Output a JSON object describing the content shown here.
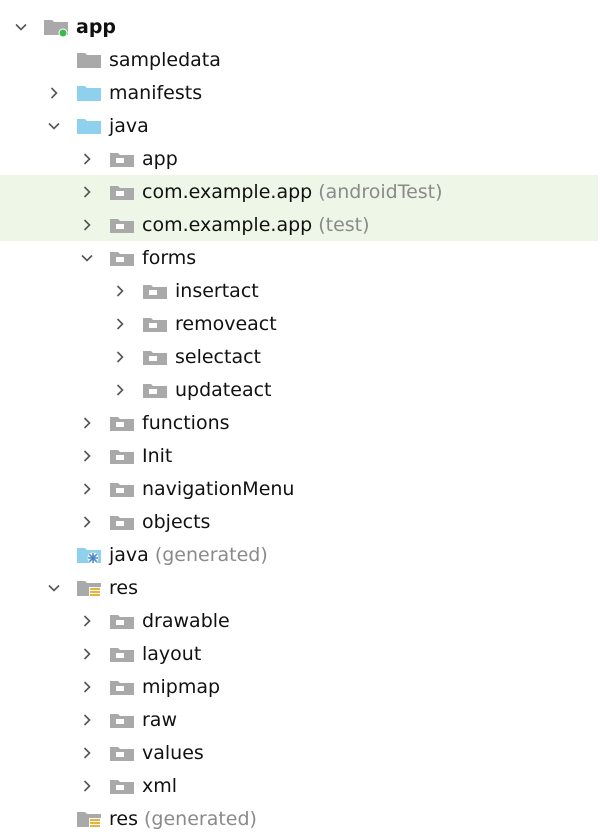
{
  "project_tree": {
    "items": [
      {
        "label": "app",
        "suffix": "",
        "depth": 0,
        "expander": "expanded",
        "icon": "module-folder-icon",
        "bold": true,
        "highlight": false
      },
      {
        "label": "sampledata",
        "suffix": "",
        "depth": 1,
        "expander": "none",
        "icon": "folder-icon",
        "bold": false,
        "highlight": false
      },
      {
        "label": "manifests",
        "suffix": "",
        "depth": 1,
        "expander": "collapsed",
        "icon": "source-folder-icon",
        "bold": false,
        "highlight": false
      },
      {
        "label": "java",
        "suffix": "",
        "depth": 1,
        "expander": "expanded",
        "icon": "source-folder-icon",
        "bold": false,
        "highlight": false
      },
      {
        "label": "app",
        "suffix": "",
        "depth": 2,
        "expander": "collapsed",
        "icon": "package-icon",
        "bold": false,
        "highlight": false
      },
      {
        "label": "com.example.app",
        "suffix": "(androidTest)",
        "depth": 2,
        "expander": "collapsed",
        "icon": "package-icon",
        "bold": false,
        "highlight": true
      },
      {
        "label": "com.example.app",
        "suffix": "(test)",
        "depth": 2,
        "expander": "collapsed",
        "icon": "package-icon",
        "bold": false,
        "highlight": true
      },
      {
        "label": "forms",
        "suffix": "",
        "depth": 2,
        "expander": "expanded",
        "icon": "package-icon",
        "bold": false,
        "highlight": false
      },
      {
        "label": "insertact",
        "suffix": "",
        "depth": 3,
        "expander": "collapsed",
        "icon": "package-icon",
        "bold": false,
        "highlight": false
      },
      {
        "label": "removeact",
        "suffix": "",
        "depth": 3,
        "expander": "collapsed",
        "icon": "package-icon",
        "bold": false,
        "highlight": false
      },
      {
        "label": "selectact",
        "suffix": "",
        "depth": 3,
        "expander": "collapsed",
        "icon": "package-icon",
        "bold": false,
        "highlight": false
      },
      {
        "label": "updateact",
        "suffix": "",
        "depth": 3,
        "expander": "collapsed",
        "icon": "package-icon",
        "bold": false,
        "highlight": false
      },
      {
        "label": "functions",
        "suffix": "",
        "depth": 2,
        "expander": "collapsed",
        "icon": "package-icon",
        "bold": false,
        "highlight": false
      },
      {
        "label": "Init",
        "suffix": "",
        "depth": 2,
        "expander": "collapsed",
        "icon": "package-icon",
        "bold": false,
        "highlight": false
      },
      {
        "label": "navigationMenu",
        "suffix": "",
        "depth": 2,
        "expander": "collapsed",
        "icon": "package-icon",
        "bold": false,
        "highlight": false
      },
      {
        "label": "objects",
        "suffix": "",
        "depth": 2,
        "expander": "collapsed",
        "icon": "package-icon",
        "bold": false,
        "highlight": false
      },
      {
        "label": "java",
        "suffix": "(generated)",
        "depth": 1,
        "expander": "none",
        "icon": "generated-source-folder-icon",
        "bold": false,
        "highlight": false
      },
      {
        "label": "res",
        "suffix": "",
        "depth": 1,
        "expander": "expanded",
        "icon": "resource-folder-icon",
        "bold": false,
        "highlight": false
      },
      {
        "label": "drawable",
        "suffix": "",
        "depth": 2,
        "expander": "collapsed",
        "icon": "package-icon",
        "bold": false,
        "highlight": false
      },
      {
        "label": "layout",
        "suffix": "",
        "depth": 2,
        "expander": "collapsed",
        "icon": "package-icon",
        "bold": false,
        "highlight": false
      },
      {
        "label": "mipmap",
        "suffix": "",
        "depth": 2,
        "expander": "collapsed",
        "icon": "package-icon",
        "bold": false,
        "highlight": false
      },
      {
        "label": "raw",
        "suffix": "",
        "depth": 2,
        "expander": "collapsed",
        "icon": "package-icon",
        "bold": false,
        "highlight": false
      },
      {
        "label": "values",
        "suffix": "",
        "depth": 2,
        "expander": "collapsed",
        "icon": "package-icon",
        "bold": false,
        "highlight": false
      },
      {
        "label": "xml",
        "suffix": "",
        "depth": 2,
        "expander": "collapsed",
        "icon": "package-icon",
        "bold": false,
        "highlight": false
      },
      {
        "label": "res",
        "suffix": "(generated)",
        "depth": 1,
        "expander": "none",
        "icon": "generated-resource-folder-icon",
        "bold": false,
        "highlight": false
      }
    ]
  },
  "colors": {
    "folder_gray": "#a9a9a9",
    "folder_blue": "#8fd0ec",
    "module_dot": "#3dba4e",
    "resource_lines": "#e8b23c",
    "generated_gear": "#4a86c8",
    "highlight_bg": "#eef6e8",
    "suffix_gray": "#8a8a8a"
  }
}
